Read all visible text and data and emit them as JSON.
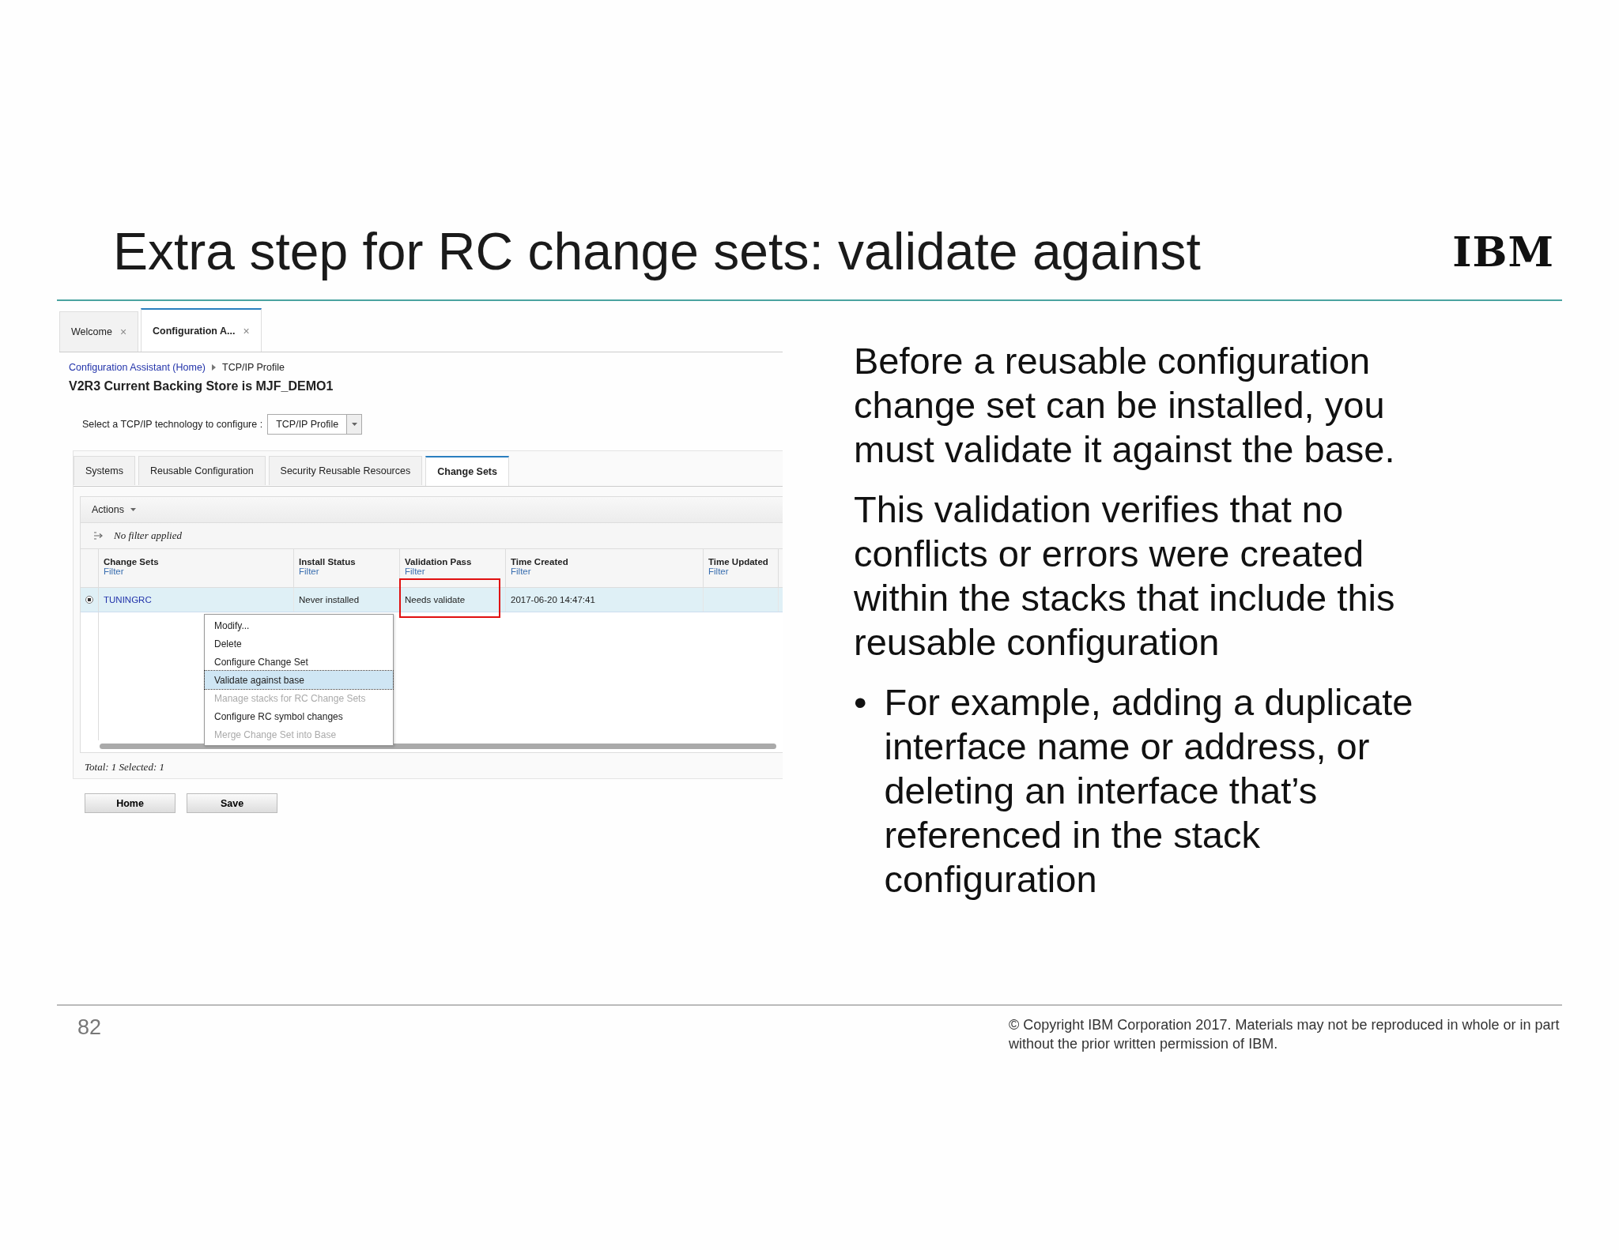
{
  "slide": {
    "title": "Extra step for RC change sets: validate against",
    "logo": "IBM",
    "page_number": "82",
    "copyright": "© Copyright IBM Corporation 2017.  Materials may not be reproduced in whole or in part without the prior written permission of IBM."
  },
  "app": {
    "tabs": [
      {
        "label": "Welcome",
        "close": "×",
        "selected": false
      },
      {
        "label": "Configuration A...",
        "close": "×",
        "selected": true
      }
    ],
    "breadcrumb": [
      {
        "kind": "link",
        "label": "Configuration Assistant (Home)"
      },
      {
        "kind": "text",
        "label": "TCP/IP Profile"
      }
    ],
    "heading": "V2R3 Current Backing Store is MJF_DEMO1",
    "technology_select": {
      "label": "Select a TCP/IP technology to configure :",
      "value": "TCP/IP Profile"
    },
    "subtabs": [
      {
        "label": "Systems",
        "selected": false
      },
      {
        "label": "Reusable Configuration",
        "selected": false
      },
      {
        "label": "Security Reusable Resources",
        "selected": false
      },
      {
        "label": "Change Sets",
        "selected": true
      }
    ],
    "actions_menu": "Actions",
    "filter_status": "No filter applied",
    "table": {
      "columns": [
        {
          "title": "Change Sets",
          "filter": "Filter"
        },
        {
          "title": "Install Status",
          "filter": "Filter"
        },
        {
          "title": "Validation Pass",
          "filter": "Filter"
        },
        {
          "title": "Time Created",
          "filter": "Filter"
        },
        {
          "title": "Time Updated",
          "filter": "Filter"
        }
      ],
      "rows": [
        {
          "selected": true,
          "change_set": "TUNINGRC",
          "install_status": "Never installed",
          "validation_pass": "Needs validate",
          "validation_callout": true,
          "time_created": "2017-06-20 14:47:41"
        }
      ]
    },
    "context_menu": [
      {
        "label": "Modify...",
        "disabled": false,
        "selected": false
      },
      {
        "label": "Delete",
        "disabled": false,
        "selected": false
      },
      {
        "label": "Configure Change Set",
        "disabled": false,
        "selected": false
      },
      {
        "label": "Validate against base",
        "disabled": false,
        "selected": true
      },
      {
        "label": "Manage stacks for RC Change Sets",
        "disabled": true,
        "selected": false
      },
      {
        "label": "Configure RC symbol changes",
        "disabled": false,
        "selected": false
      },
      {
        "label": "Merge Change Set into Base",
        "disabled": true,
        "selected": false
      }
    ],
    "table_footer": "Total: 1 Selected: 1",
    "buttons": [
      "Home",
      "Save"
    ]
  },
  "body": [
    {
      "kind": "paragraph",
      "text": "Before a reusable configuration change set can be installed, you must validate it against the base."
    },
    {
      "kind": "paragraph",
      "text": "This validation verifies that no conflicts or errors were created within the stacks that include this reusable configuration"
    },
    {
      "kind": "bullet",
      "bullet": "•",
      "text": "For example, adding a duplicate interface name or address, or deleting an interface that’s referenced in the stack configuration"
    }
  ]
}
